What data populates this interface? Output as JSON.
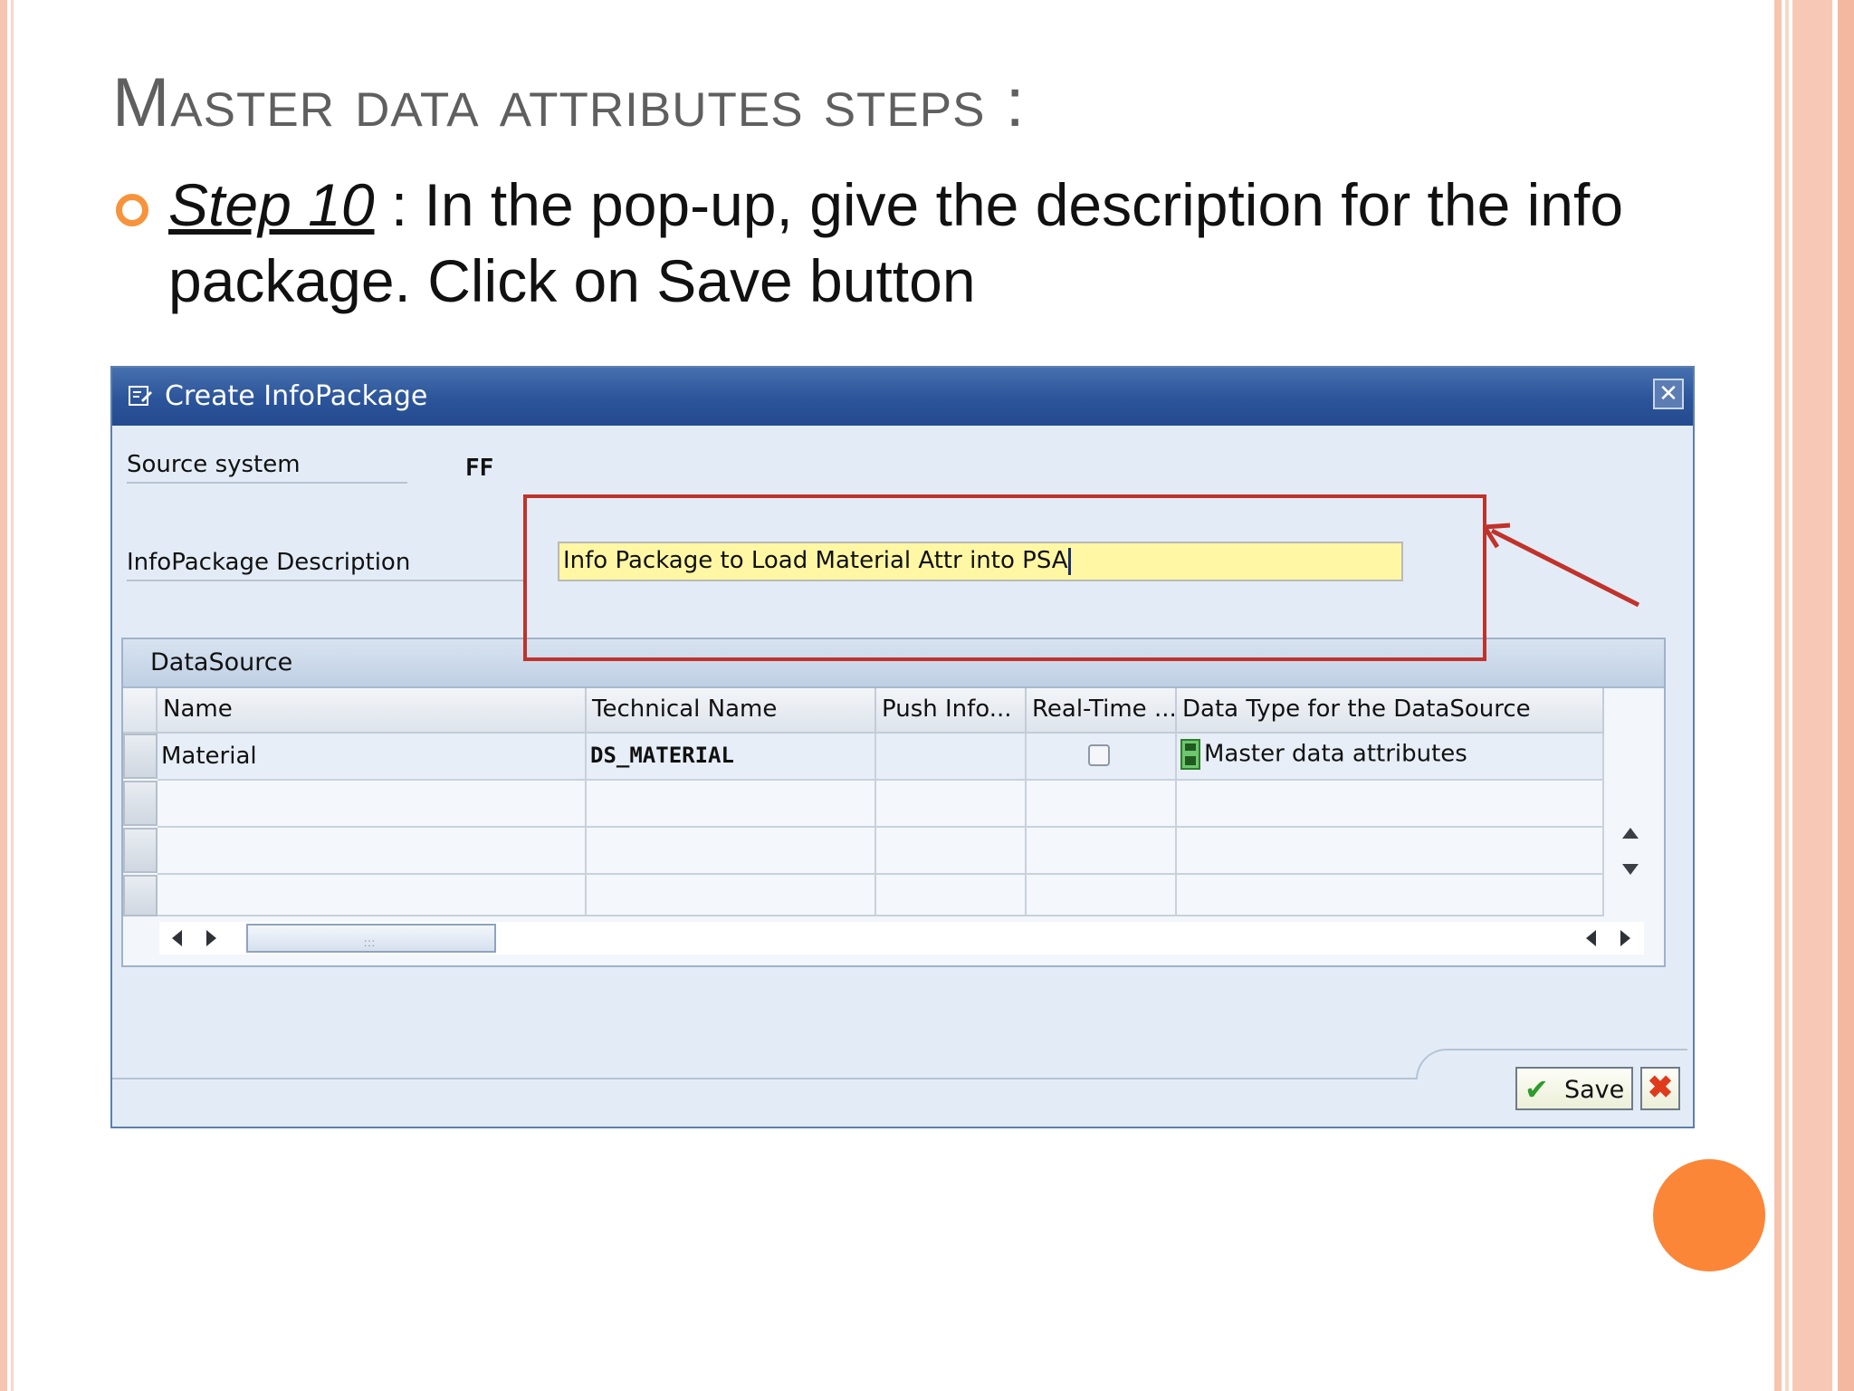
{
  "slide": {
    "title": "Master data attributes steps :",
    "bullet_step": "Step 10",
    "bullet_text": " : In the pop-up, give the description for the info package. Click on Save button"
  },
  "dialog": {
    "title": "Create InfoPackage",
    "close_symbol": "✕",
    "source_system_label": "Source system",
    "source_system_value": "FF",
    "description_label": "InfoPackage Description",
    "description_value": "Info Package to Load Material Attr into PSA",
    "datasource_title": "DataSource",
    "columns": [
      "Name",
      "Technical Name",
      "Push Info...",
      "Real-Time ...",
      "Data Type for the DataSource"
    ],
    "rows": [
      {
        "name": "Material",
        "technical_name": "DS_MATERIAL",
        "push_info": "",
        "real_time": false,
        "data_type": "Master data attributes"
      }
    ],
    "save_label": "Save",
    "cancel_symbol": "✖"
  },
  "colors": {
    "accent_orange": "#fb8637",
    "highlight_red": "#c0322b",
    "titlebar_blue": "#2c549a",
    "input_yellow": "#fff7a4"
  },
  "icons": [
    "create-infopackage-icon",
    "close-icon",
    "column-config-icon",
    "datasource-type-icon",
    "checkmark-icon",
    "cancel-icon",
    "scroll-up-icon",
    "scroll-down-icon",
    "scroll-left-icon",
    "scroll-right-icon"
  ]
}
